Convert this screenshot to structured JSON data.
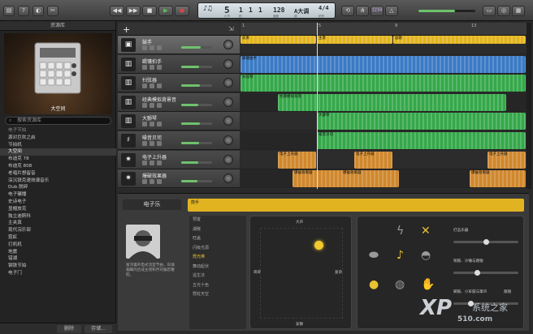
{
  "library": {
    "title": "资源库",
    "image_caption": "大空间",
    "search_placeholder": "搜索资源库",
    "sections": [
      {
        "label": "电子节拍",
        "type": "section"
      },
      {
        "label": "源对巨欢之启",
        "type": "item"
      },
      {
        "label": "节拍机",
        "type": "item"
      },
      {
        "label": "大空间",
        "type": "selected"
      },
      {
        "label": "布迪克 78",
        "type": "item"
      },
      {
        "label": "布迪克 808",
        "type": "item"
      },
      {
        "label": "老唱片想留音",
        "type": "item"
      },
      {
        "label": "深沉铁克速效谱音乐",
        "type": "item"
      },
      {
        "label": "Dub 脱碎",
        "type": "item"
      },
      {
        "label": "电子碾播",
        "type": "item"
      },
      {
        "label": "史诗电子",
        "type": "item"
      },
      {
        "label": "显帽放克",
        "type": "item"
      },
      {
        "label": "独立迪斯科",
        "type": "item"
      },
      {
        "label": "主夹真",
        "type": "item"
      },
      {
        "label": "现代浣乐部",
        "type": "item"
      },
      {
        "label": "霓虹",
        "type": "item"
      },
      {
        "label": "打机机",
        "type": "item"
      },
      {
        "label": "地震",
        "type": "item"
      },
      {
        "label": "错湖",
        "type": "item"
      },
      {
        "label": "钢铁节拍",
        "type": "item"
      },
      {
        "label": "电子门",
        "type": "item"
      }
    ],
    "footer": {
      "delete": "删除",
      "save": "存储..."
    }
  },
  "toolbar": {
    "lcd": {
      "bar": "5",
      "beat": "1",
      "division": "1",
      "tick": "1",
      "tempo": "128",
      "key": "A大调",
      "time_sig": "4/4",
      "labels": [
        "小节",
        "拍",
        "",
        "",
        "速度",
        "调",
        "拍号"
      ]
    },
    "count_in": "1234",
    "icons": [
      "library-icon",
      "help-icon",
      "smart-controls-icon",
      "editors-icon",
      "rewind-icon",
      "forward-icon",
      "stop-icon",
      "play-icon",
      "record-icon",
      "cycle-icon",
      "tuner-icon",
      "metronome-icon",
      "notepad-icon",
      "loop-browser-icon",
      "media-browser-icon"
    ]
  },
  "tracks": [
    {
      "name": "鼓手",
      "icon": "drummer-icon",
      "selected": true,
      "volume": 0.62
    },
    {
      "name": "踢镶拍手",
      "icon": "drum-machine-icon",
      "selected": false,
      "volume": 0.58
    },
    {
      "name": "扫弦器",
      "icon": "keyboard-icon",
      "selected": false,
      "volume": 0.6
    },
    {
      "name": "经典模拟背景音",
      "icon": "synth-icon",
      "selected": false,
      "volume": 0.55
    },
    {
      "name": "大颤琴",
      "icon": "synth-icon",
      "selected": false,
      "volume": 0.6
    },
    {
      "name": "噪音贝司",
      "icon": "bass-icon",
      "selected": false,
      "volume": 0.57
    },
    {
      "name": "电子上升器",
      "icon": "fx-icon",
      "selected": false,
      "volume": 0.55
    },
    {
      "name": "爆破效果器",
      "icon": "fx-icon",
      "selected": false,
      "volume": 0.52
    }
  ],
  "ruler": {
    "ticks": [
      "1",
      "5",
      "9",
      "13",
      "17"
    ]
  },
  "regions": [
    {
      "lane": 0,
      "start": 0,
      "end": 94,
      "label": "前奏",
      "color": "#e3b51e"
    },
    {
      "lane": 0,
      "start": 94,
      "end": 188,
      "label": "主歌",
      "color": "#e3b51e"
    },
    {
      "lane": 0,
      "start": 188,
      "end": 352,
      "label": "副歌",
      "color": "#e3b51e"
    },
    {
      "lane": 1,
      "start": 0,
      "end": 352,
      "label": "踢镶拍手",
      "color": "#3b7ac4"
    },
    {
      "lane": 2,
      "start": 0,
      "end": 352,
      "label": "扫弦琴",
      "color": "#35a84a"
    },
    {
      "lane": 3,
      "start": 46,
      "end": 328,
      "label": "经典模拟背景",
      "color": "#35a84a"
    },
    {
      "lane": 4,
      "start": 94,
      "end": 352,
      "label": "大颤琴",
      "color": "#35a84a"
    },
    {
      "lane": 5,
      "start": 94,
      "end": 352,
      "label": "噪音贝司",
      "color": "#35a84a"
    },
    {
      "lane": 6,
      "start": 46,
      "end": 94,
      "label": "电子上升器",
      "color": "#d0872c"
    },
    {
      "lane": 6,
      "start": 140,
      "end": 188,
      "label": "电子上升器",
      "color": "#d0872c"
    },
    {
      "lane": 6,
      "start": 304,
      "end": 352,
      "label": "电子上升器",
      "color": "#d0872c"
    },
    {
      "lane": 7,
      "start": 64,
      "end": 140,
      "label": "爆破效果器",
      "color": "#d0872c"
    },
    {
      "lane": 7,
      "start": 124,
      "end": 196,
      "label": "爆破效果器",
      "color": "#d0872c"
    },
    {
      "lane": 7,
      "start": 282,
      "end": 352,
      "label": "爆破效果器",
      "color": "#d0872c"
    }
  ],
  "editor": {
    "title": "电子乐",
    "region_label": "鼓手",
    "drummer_description": "富鸿着的电式流室节拍，向诵偏蝶的合成主夜和月司偏音鞭腔。",
    "presets": [
      {
        "label": "预置",
        "selected": false
      },
      {
        "label": "湖散",
        "selected": false
      },
      {
        "label": "旺盖",
        "selected": false
      },
      {
        "label": "闪级光源",
        "selected": false
      },
      {
        "label": "霓光棒",
        "selected": true
      },
      {
        "label": "舞动起伏",
        "selected": false
      },
      {
        "label": "遥生法",
        "selected": false
      },
      {
        "label": "五光十色",
        "selected": false
      },
      {
        "label": "霓虹天空",
        "selected": false
      }
    ],
    "xy": {
      "top": "大声",
      "bottom": "安静",
      "left": "简单",
      "right": "复杂"
    },
    "drum_controls": [
      {
        "label": "打击乐器",
        "value": 0.5
      },
      {
        "label": "铜鼓、沙锤与踏钹",
        "value": 0.35
      },
      {
        "label": "脚鼓、小军鼓与掌声",
        "value": 0.25
      }
    ],
    "follow_label": "跟随"
  },
  "watermark": {
    "brand": "XP",
    "domain": "510.com",
    "site": "系统之家"
  },
  "colors": {
    "accent": "#e3b51e",
    "selected_preset": "#e8c232",
    "play_green": "#57c057",
    "record_red": "#d64545"
  }
}
